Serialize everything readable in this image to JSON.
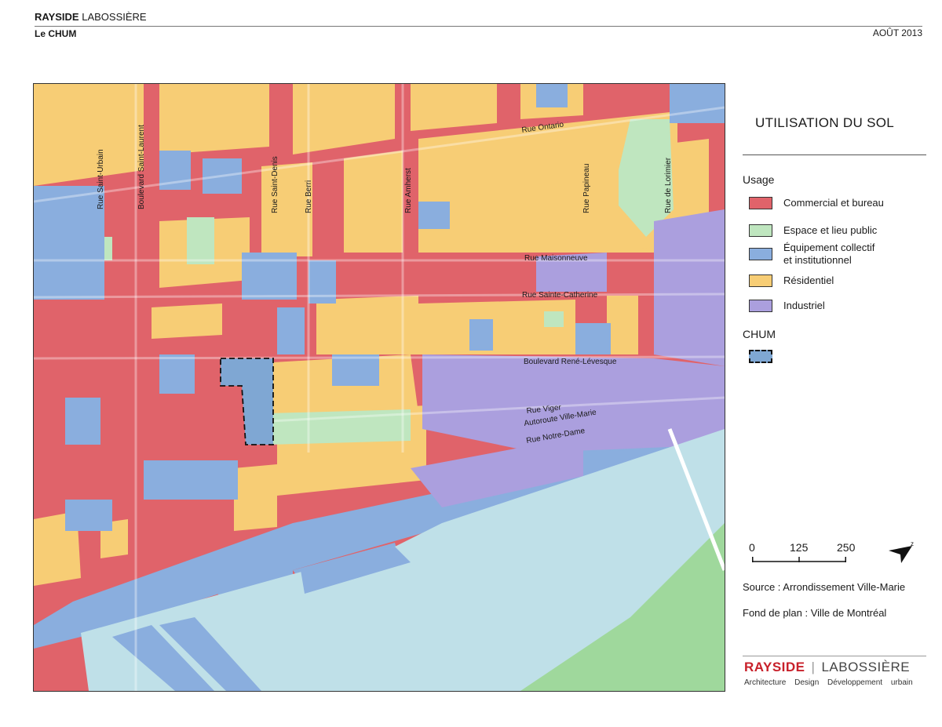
{
  "header": {
    "firm_bold": "RAYSIDE",
    "firm_rest": " LABOSSIÈRE",
    "project": "Le CHUM",
    "date": "AOÛT 2013"
  },
  "legend": {
    "title": "UTILISATION DU SOL",
    "usage_title": "Usage",
    "items": [
      {
        "label": "Commercial et bureau",
        "color": "#e0636a"
      },
      {
        "label": "Espace et lieu public",
        "color": "#bfe6bf"
      },
      {
        "label_line1": "Équipement collectif",
        "label_line2": "et institutionnel",
        "color": "#8aaede"
      },
      {
        "label": "Résidentiel",
        "color": "#f7cd75"
      },
      {
        "label": "Industriel",
        "color": "#ab9fde"
      }
    ],
    "chum_title": "CHUM",
    "chum_color": "#7fa7d3"
  },
  "scale": {
    "labels": [
      "0",
      "125",
      "250"
    ]
  },
  "credits": {
    "source": "Source : Arrondissement Ville-Marie",
    "basemap": "Fond de plan : Ville de Montréal"
  },
  "logo": {
    "red": "RAYSIDE",
    "sep": "|",
    "grey": "LABOSSIÈRE",
    "tagline": "Architecture Design Développement urbain"
  },
  "map": {
    "streets": {
      "rue_ontario": "Rue Ontario",
      "rue_maisonneuve": "Rue Maisonneuve",
      "rue_sainte_catherine": "Rue Sainte-Catherine",
      "boulevard_rene_levesque": "Boulevard René-Lévesque",
      "rue_viger": "Rue Viger",
      "autoroute_ville_marie": "Autoroute Ville-Marie",
      "rue_notre_dame": "Rue Notre-Dame",
      "rue_saint_urbain": "Rue Saint-Urbain",
      "boulevard_saint_laurent": "Boulevard Saint-Laurent",
      "rue_saint_denis": "Rue Saint-Denis",
      "rue_berri": "Rue Berri",
      "rue_amherst": "Rue Amherst",
      "rue_papineau": "Rue Papineau",
      "rue_de_lorimier": "Rue de Lorimier"
    },
    "colors": {
      "commercial": "#e0636a",
      "public": "#bfe6bf",
      "institutional": "#8aaede",
      "residential": "#f7cd75",
      "industrial": "#ab9fde",
      "water": "#bfe0e8",
      "park": "#9fd89c"
    }
  }
}
